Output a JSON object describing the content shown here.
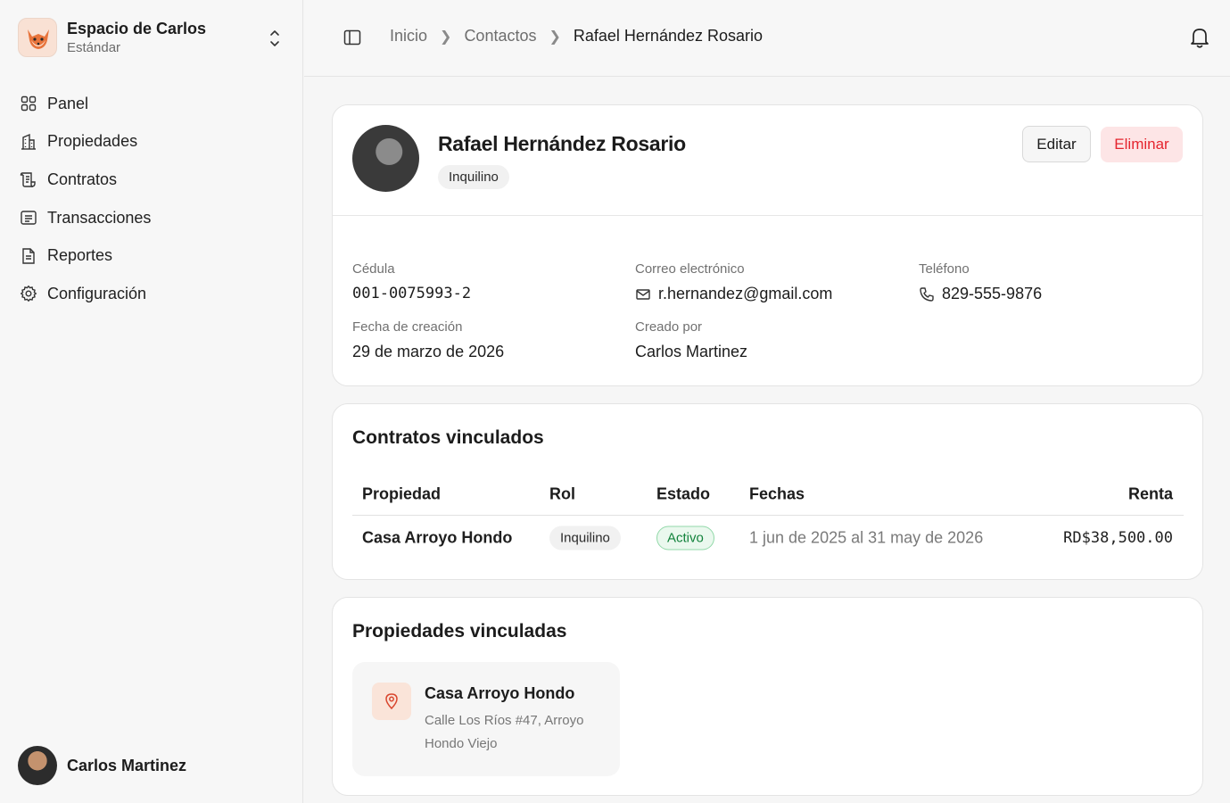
{
  "workspace": {
    "name": "Espacio de Carlos",
    "plan": "Estándar"
  },
  "nav": [
    {
      "label": "Panel",
      "icon": "grid-icon"
    },
    {
      "label": "Propiedades",
      "icon": "building-icon"
    },
    {
      "label": "Contratos",
      "icon": "scroll-icon"
    },
    {
      "label": "Transacciones",
      "icon": "receipt-icon"
    },
    {
      "label": "Reportes",
      "icon": "file-icon"
    },
    {
      "label": "Configuración",
      "icon": "gear-icon"
    }
  ],
  "user": {
    "name": "Carlos Martinez"
  },
  "breadcrumb": {
    "home": "Inicio",
    "section": "Contactos",
    "current": "Rafael Hernández Rosario"
  },
  "profile": {
    "name": "Rafael Hernández Rosario",
    "role": "Inquilino",
    "edit_label": "Editar",
    "delete_label": "Eliminar"
  },
  "details": {
    "cedula_label": "Cédula",
    "cedula": "001-0075993-2",
    "email_label": "Correo electrónico",
    "email": "r.hernandez@gmail.com",
    "phone_label": "Teléfono",
    "phone": "829-555-9876",
    "created_label": "Fecha de creación",
    "created": "29 de marzo de 2026",
    "creator_label": "Creado por",
    "creator": "Carlos Martinez"
  },
  "contracts": {
    "title": "Contratos vinculados",
    "headers": {
      "property": "Propiedad",
      "role": "Rol",
      "status": "Estado",
      "dates": "Fechas",
      "rent": "Renta"
    },
    "rows": [
      {
        "property": "Casa Arroyo Hondo",
        "role": "Inquilino",
        "status": "Activo",
        "dates": "1 jun de 2025 al 31 may de 2026",
        "rent": "RD$38,500.00"
      }
    ]
  },
  "properties": {
    "title": "Propiedades vinculadas",
    "items": [
      {
        "name": "Casa Arroyo Hondo",
        "address": "Calle Los Ríos #47, Arroyo Hondo Viejo"
      }
    ]
  },
  "colors": {
    "danger": "#e5252f",
    "success": "#11823b",
    "accent": "#e8743b"
  }
}
